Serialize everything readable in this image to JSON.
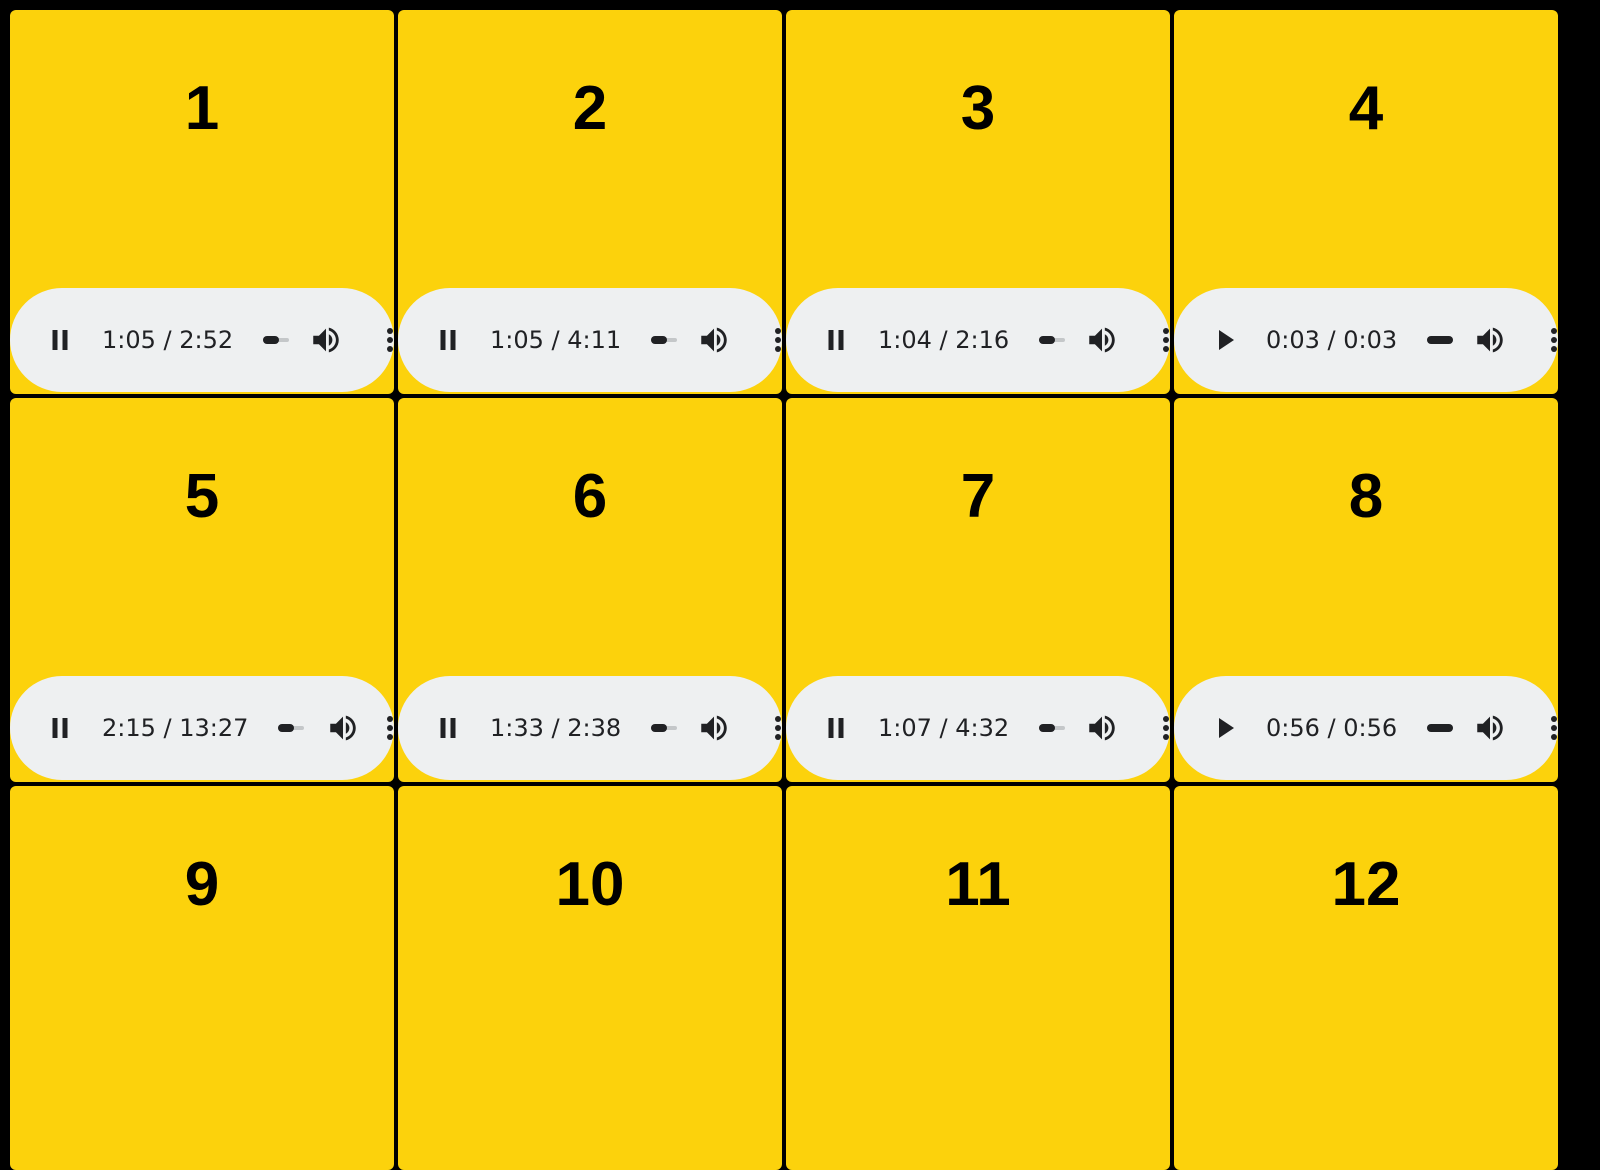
{
  "colors": {
    "background": "#000000",
    "tile": "#fcd20c",
    "player": "#eef0f1",
    "control": "#202124"
  },
  "tiles": [
    {
      "number": "1",
      "player": {
        "state": "playing",
        "icon": "pause-icon",
        "time": "1:05 / 2:52",
        "volume": 0.6
      }
    },
    {
      "number": "2",
      "player": {
        "state": "playing",
        "icon": "pause-icon",
        "time": "1:05 / 4:11",
        "volume": 0.6
      }
    },
    {
      "number": "3",
      "player": {
        "state": "playing",
        "icon": "pause-icon",
        "time": "1:04 / 2:16",
        "volume": 0.6
      }
    },
    {
      "number": "4",
      "player": {
        "state": "ended",
        "icon": "play-icon",
        "time": "0:03 / 0:03",
        "volume": 1.0
      }
    },
    {
      "number": "5",
      "player": {
        "state": "playing",
        "icon": "pause-icon",
        "time": "2:15 / 13:27",
        "volume": 0.6
      }
    },
    {
      "number": "6",
      "player": {
        "state": "playing",
        "icon": "pause-icon",
        "time": "1:33 / 2:38",
        "volume": 0.6
      }
    },
    {
      "number": "7",
      "player": {
        "state": "playing",
        "icon": "pause-icon",
        "time": "1:07 / 4:32",
        "volume": 0.6
      }
    },
    {
      "number": "8",
      "player": {
        "state": "ended",
        "icon": "play-icon",
        "time": "0:56 / 0:56",
        "volume": 1.0
      }
    },
    {
      "number": "9",
      "player": null
    },
    {
      "number": "10",
      "player": null
    },
    {
      "number": "11",
      "player": null
    },
    {
      "number": "12",
      "player": null
    }
  ]
}
